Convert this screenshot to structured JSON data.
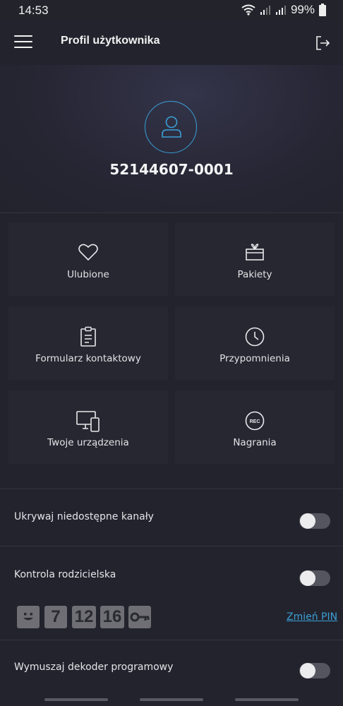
{
  "status_bar": {
    "time": "14:53",
    "battery": "99%"
  },
  "app_bar": {
    "title": "Profil użytkownika",
    "menu_icon": "hamburger-menu-icon",
    "logout_icon": "logout-icon"
  },
  "profile": {
    "user_id": "52144607-0001",
    "avatar_icon": "user-icon",
    "accent_color": "#3aa0d6"
  },
  "tiles": [
    {
      "label": "Ulubione",
      "icon": "heart-icon"
    },
    {
      "label": "Pakiety",
      "icon": "gift-icon"
    },
    {
      "label": "Formularz kontaktowy",
      "icon": "clipboard-icon"
    },
    {
      "label": "Przypomnienia",
      "icon": "clock-icon"
    },
    {
      "label": "Twoje urządzenia",
      "icon": "devices-icon"
    },
    {
      "label": "Nagrania",
      "icon": "rec-icon",
      "badge": "REC"
    }
  ],
  "settings": [
    {
      "label": "Ukrywaj niedostępne kanały",
      "enabled": false
    },
    {
      "label": "Kontrola rodzicielska",
      "enabled": false
    },
    {
      "label": "Wymuszaj dekoder programowy",
      "enabled": false
    }
  ],
  "parental": {
    "ratings": [
      {
        "label": "",
        "icon": "smiley-icon"
      },
      {
        "label": "7"
      },
      {
        "label": "12"
      },
      {
        "label": "16"
      },
      {
        "label": "",
        "icon": "key-icon"
      }
    ],
    "change_pin": "Zmień PIN"
  }
}
